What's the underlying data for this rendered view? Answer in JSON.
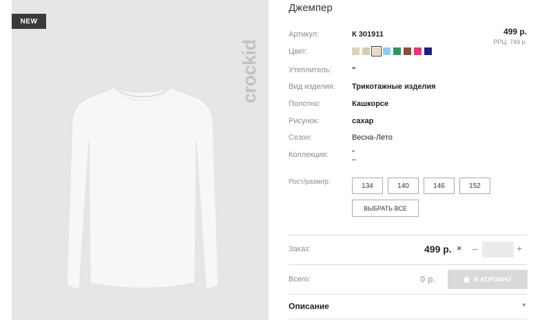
{
  "product": {
    "title": "Джемпер",
    "badge": "NEW",
    "brand": "crockid",
    "price": "499 р.",
    "rrp": "РРЦ: 749 р."
  },
  "attributes": [
    {
      "label": "Артикул:",
      "value": "К 301911"
    },
    {
      "label": "Цвет:",
      "value": ""
    },
    {
      "label": "Утеплитель:",
      "value": "\""
    },
    {
      "label": "Вид изделия:",
      "value": "Трикотажные изделия"
    },
    {
      "label": "Полотно:",
      "value": "Кашкорсе"
    },
    {
      "label": "Рисунок:",
      "value": "сахар"
    },
    {
      "label": "Сезон:",
      "value": "Весна-Лето"
    },
    {
      "label": "Коллекция:",
      "value": "\"\n–"
    }
  ],
  "colors": [
    "#ddd0b7",
    "#d9cdb0",
    "#e5dac2",
    "#8ecbf1",
    "#33955a",
    "#8b4a3a",
    "#e8347c",
    "#1c1e86"
  ],
  "size": {
    "label": "Рост/размер:",
    "options": [
      "134",
      "140",
      "146",
      "152"
    ],
    "select_all": "ВЫБРАТЬ ВСЕ"
  },
  "order": {
    "label": "Заказ:",
    "price": "499 р.",
    "times": "×",
    "minus": "–",
    "plus": "+",
    "quantity": ""
  },
  "total": {
    "label": "Всего:",
    "value": "0 р.",
    "cart_button": "В КОРЗИНУ"
  },
  "description": {
    "label": "Описание",
    "arrow": "▼"
  }
}
